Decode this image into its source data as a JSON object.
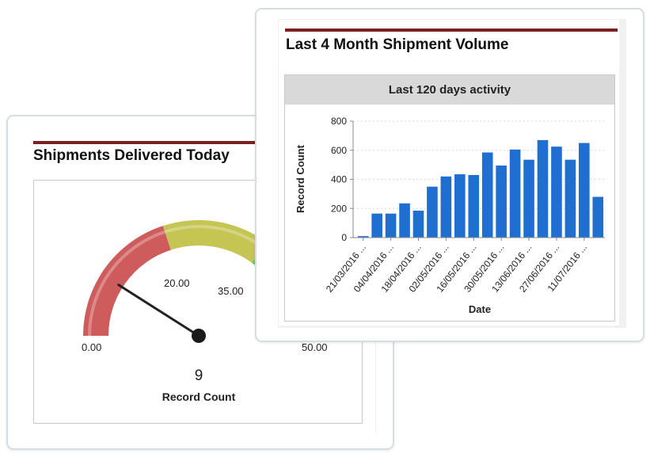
{
  "gauge_card": {
    "title": "Shipments Delivered Today",
    "gauge": {
      "min_label": "0.00",
      "max_label": "50.00",
      "tick_labels": [
        "20.00",
        "35.00"
      ],
      "value": 9,
      "value_label": "9",
      "measure_label": "Record Count",
      "min": 0,
      "max": 50,
      "ranges": [
        {
          "from": 0,
          "to": 20,
          "color": "#cf5c5c"
        },
        {
          "from": 20,
          "to": 35,
          "color": "#c4c553"
        },
        {
          "from": 35,
          "to": 50,
          "color": "#6fcc48"
        }
      ]
    }
  },
  "chart_card": {
    "title": "Last 4 Month Shipment Volume",
    "chart_header": "Last 120 days activity"
  },
  "chart_data": {
    "type": "bar",
    "title": "Last 120 days activity",
    "xlabel": "Date",
    "ylabel": "Record Count",
    "ylim": [
      0,
      800
    ],
    "yticks": [
      "0",
      "200",
      "400",
      "600",
      "800"
    ],
    "bar_color": "#1f6fd1",
    "grid": true,
    "xtick_labels": [
      "21/03/2016 ...",
      "04/04/2016 ...",
      "18/04/2016 ...",
      "02/05/2016 ...",
      "16/05/2016 ...",
      "30/05/2016 ...",
      "13/06/2016 ...",
      "27/06/2016 ...",
      "11/07/2016 ..."
    ],
    "values": [
      10,
      165,
      165,
      235,
      185,
      350,
      420,
      435,
      430,
      585,
      495,
      605,
      535,
      670,
      625,
      535,
      650,
      280
    ]
  }
}
